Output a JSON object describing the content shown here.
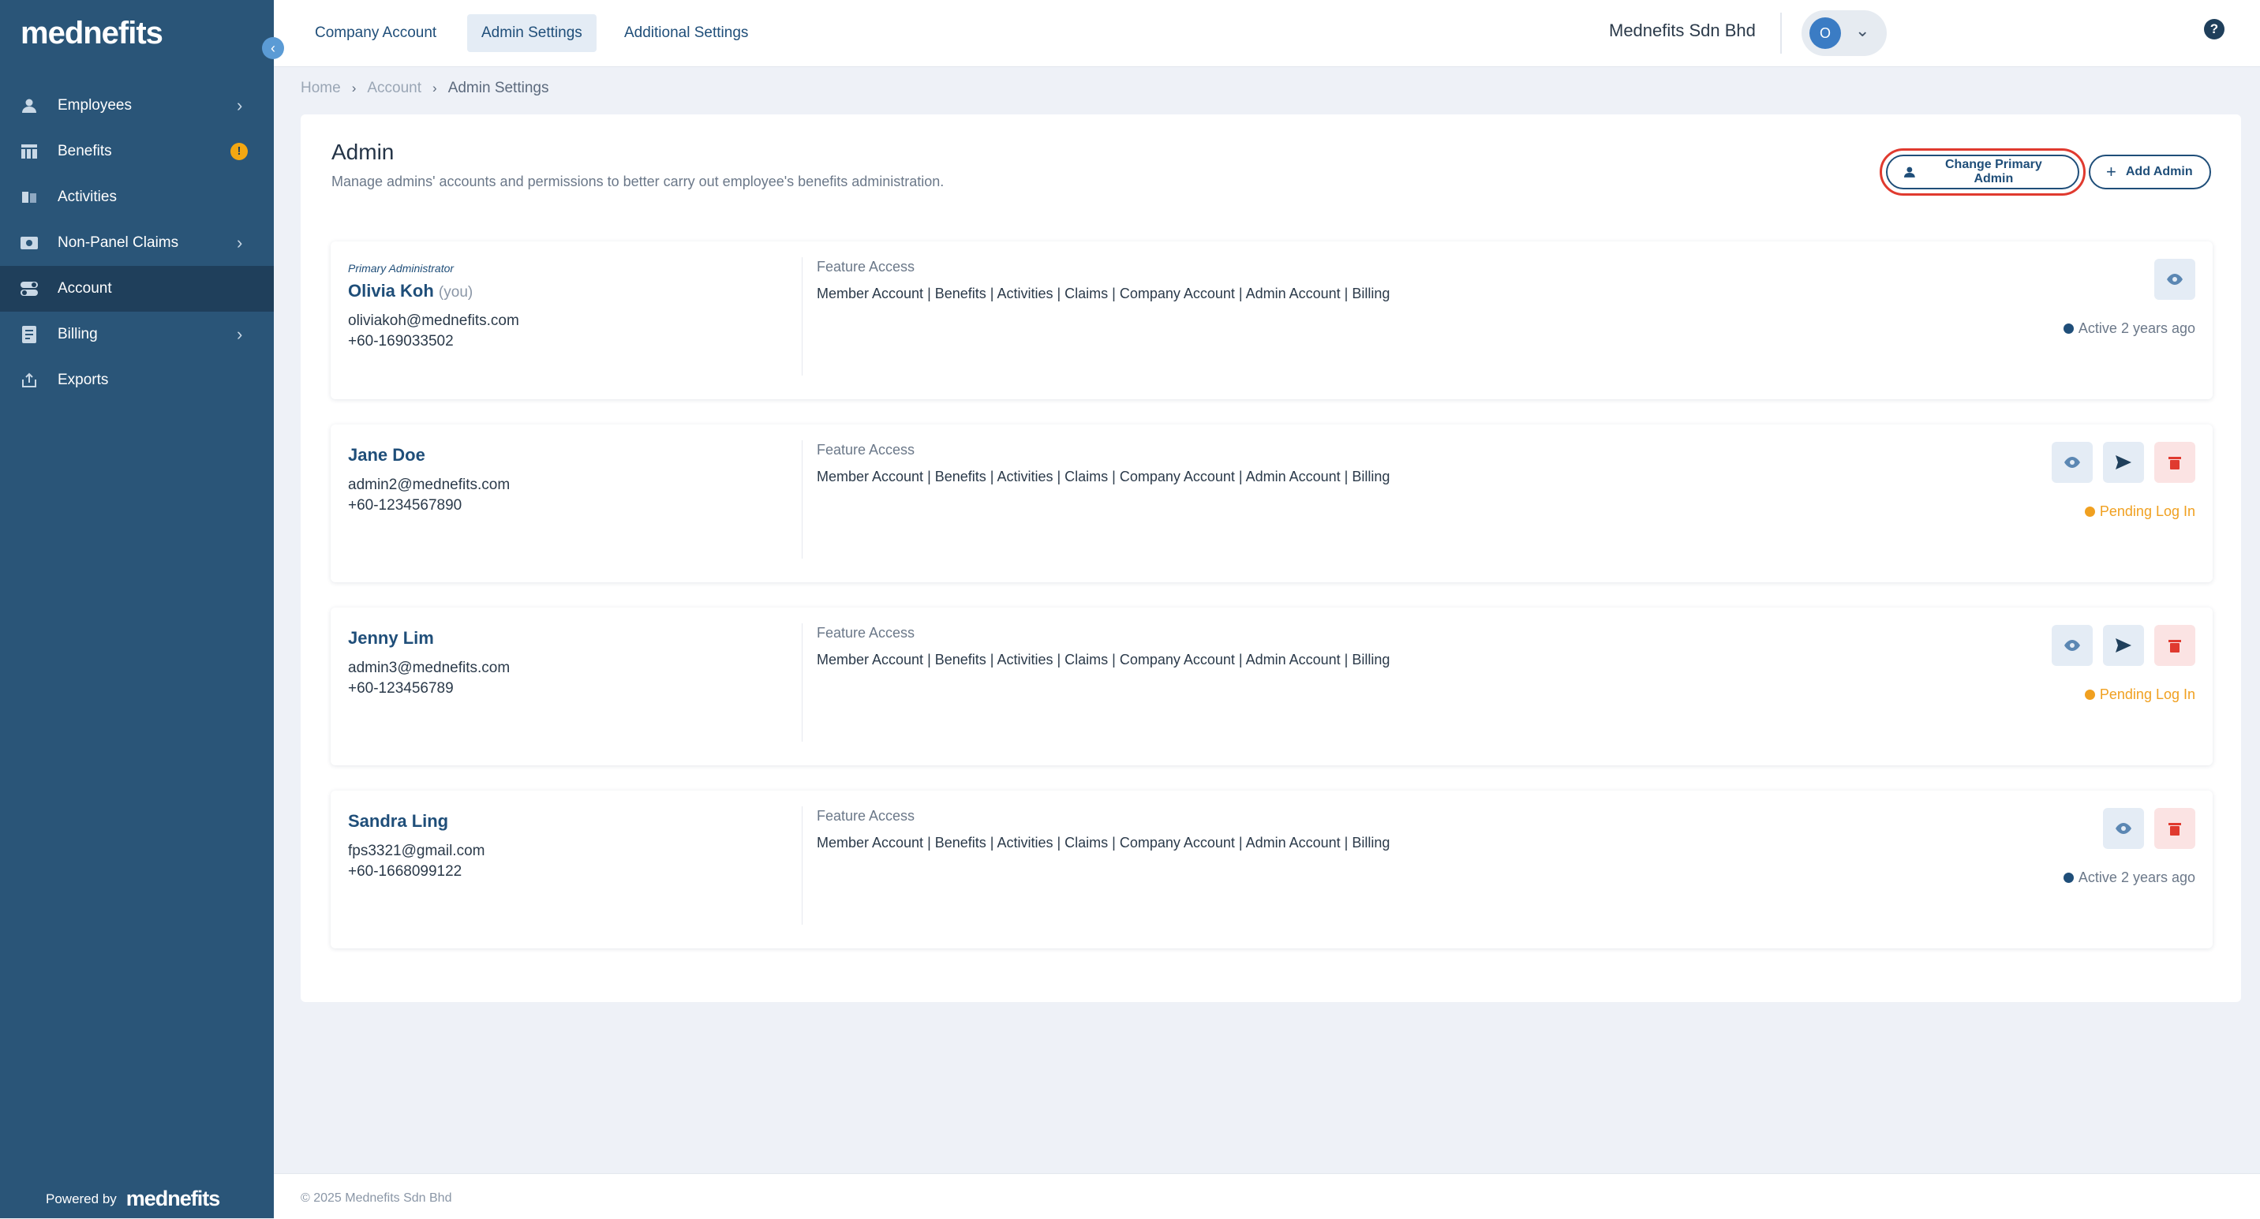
{
  "brand": {
    "logo": "mednefits",
    "powered_by": "Powered by",
    "powered_logo": "mednefits"
  },
  "sidebar": {
    "items": [
      {
        "label": "Employees",
        "icon": "person-icon",
        "has_chevron": true
      },
      {
        "label": "Benefits",
        "icon": "table-icon",
        "badge": "!"
      },
      {
        "label": "Activities",
        "icon": "book-icon"
      },
      {
        "label": "Non-Panel Claims",
        "icon": "cash-icon",
        "has_chevron": true
      },
      {
        "label": "Account",
        "icon": "toggle-icon",
        "active": true
      },
      {
        "label": "Billing",
        "icon": "receipt-icon",
        "has_chevron": true
      },
      {
        "label": "Exports",
        "icon": "export-icon"
      }
    ]
  },
  "topbar": {
    "tabs": [
      "Company Account",
      "Admin Settings",
      "Additional Settings"
    ],
    "active_tab": "Admin Settings",
    "company": "Mednefits Sdn Bhd",
    "avatar_initial": "O",
    "help": "?"
  },
  "breadcrumb": {
    "home": "Home",
    "account": "Account",
    "current": "Admin Settings"
  },
  "admin": {
    "title": "Admin",
    "subtitle": "Manage admins' accounts and permissions to better carry out employee's benefits administration.",
    "change_primary_label": "Change Primary Admin",
    "add_admin_label": "Add Admin"
  },
  "admins": [
    {
      "role": "Primary Administrator",
      "name": "Olivia Koh",
      "you": "(you)",
      "email": "oliviakoh@mednefits.com",
      "phone": "+60-169033502",
      "feature_title": "Feature Access",
      "features": "Member Account | Benefits | Activities | Claims | Company Account | Admin Account | Billing",
      "status": "Active 2 years ago"
    },
    {
      "name": "Jane Doe",
      "email": "admin2@mednefits.com",
      "phone": "+60-1234567890",
      "feature_title": "Feature Access",
      "features": "Member Account | Benefits | Activities | Claims | Company Account | Admin Account | Billing",
      "status": "Pending Log In"
    },
    {
      "name": "Jenny Lim",
      "email": "admin3@mednefits.com",
      "phone": "+60-123456789",
      "feature_title": "Feature Access",
      "features": "Member Account | Benefits | Activities | Claims | Company Account | Admin Account | Billing",
      "status": "Pending Log In"
    },
    {
      "name": "Sandra Ling",
      "email": "fps3321@gmail.com",
      "phone": "+60-1668099122",
      "feature_title": "Feature Access",
      "features": "Member Account | Benefits | Activities | Claims | Company Account | Admin Account | Billing",
      "status": "Active 2 years ago"
    }
  ],
  "footer": {
    "copyright": "© 2025 Mednefits Sdn Bhd"
  },
  "colors": {
    "sidebar": "#2a5578",
    "sidebar_active": "#1f3f5b",
    "primary": "#1f4e79",
    "pending": "#f0a020",
    "danger": "#e03a2f"
  }
}
